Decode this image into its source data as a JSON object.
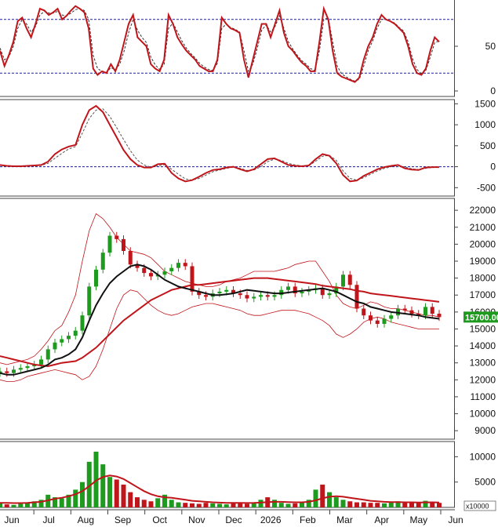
{
  "chart_data": [
    {
      "panel": "stochastic",
      "type": "line",
      "ylim": [
        0,
        100
      ],
      "y_ticks": [
        0,
        50
      ],
      "reference_lines": [
        20,
        80
      ],
      "grid": false,
      "colors": {
        "k_line": "#c0151a",
        "d_line": "#333333",
        "reference": "#1a1aa0"
      },
      "series": [
        {
          "values": [
            45,
            28,
            40,
            55,
            78,
            82,
            70,
            60,
            75,
            92,
            90,
            85,
            88,
            92,
            80,
            84,
            90,
            95,
            92,
            88,
            70,
            25,
            18,
            22,
            20,
            30,
            22,
            35,
            55,
            75,
            85,
            60,
            55,
            50,
            30,
            25,
            22,
            35,
            85,
            75,
            60,
            52,
            45,
            40,
            35,
            28,
            25,
            22,
            22,
            35,
            82,
            75,
            70,
            68,
            65,
            35,
            15,
            35,
            55,
            75,
            75,
            60,
            75,
            90,
            65,
            50,
            45,
            38,
            32,
            28,
            22,
            22,
            55,
            92,
            80,
            45,
            20,
            16,
            14,
            12,
            10,
            15,
            35,
            50,
            60,
            75,
            85,
            80,
            78,
            75,
            70,
            65,
            50,
            30,
            20,
            18,
            25,
            45,
            60,
            55
          ]
        },
        {
          "values": [
            48,
            35,
            38,
            50,
            70,
            80,
            75,
            66,
            72,
            85,
            89,
            87,
            87,
            89,
            85,
            84,
            87,
            91,
            92,
            90,
            80,
            40,
            25,
            22,
            21,
            26,
            24,
            30,
            45,
            65,
            80,
            68,
            60,
            54,
            38,
            29,
            24,
            30,
            70,
            76,
            66,
            56,
            48,
            42,
            37,
            31,
            27,
            24,
            23,
            31,
            70,
            75,
            71,
            69,
            66,
            45,
            22,
            30,
            48,
            68,
            74,
            66,
            72,
            84,
            70,
            55,
            47,
            40,
            34,
            30,
            25,
            23,
            45,
            80,
            82,
            55,
            28,
            19,
            16,
            13,
            11,
            13,
            28,
            45,
            56,
            70,
            80,
            80,
            78,
            76,
            71,
            67,
            55,
            36,
            24,
            19,
            23,
            38,
            54,
            56
          ]
        }
      ]
    },
    {
      "panel": "macd",
      "type": "line",
      "ylim": [
        -700,
        1600
      ],
      "y_ticks": [
        1500,
        1000,
        500,
        0,
        -500
      ],
      "reference_lines": [
        0
      ],
      "grid": false,
      "colors": {
        "macd_line": "#c0151a",
        "signal_line": "#555555",
        "reference": "#1a1aa0"
      },
      "series": [
        {
          "values": [
            40,
            20,
            10,
            10,
            20,
            30,
            40,
            120,
            300,
            410,
            480,
            520,
            1000,
            1350,
            1450,
            1300,
            1000,
            700,
            400,
            180,
            40,
            -20,
            -20,
            60,
            70,
            -150,
            -280,
            -350,
            -320,
            -240,
            -150,
            -80,
            -60,
            -20,
            0,
            -60,
            -110,
            -60,
            60,
            180,
            200,
            120,
            40,
            20,
            10,
            30,
            180,
            300,
            260,
            80,
            -200,
            -350,
            -330,
            -220,
            -140,
            -60,
            -10,
            20,
            40,
            -40,
            -70,
            -80,
            -20,
            -10,
            -10
          ]
        },
        {
          "values": [
            30,
            25,
            18,
            14,
            16,
            22,
            30,
            80,
            200,
            320,
            420,
            480,
            800,
            1150,
            1350,
            1380,
            1200,
            930,
            650,
            380,
            160,
            40,
            -10,
            20,
            50,
            -60,
            -180,
            -290,
            -320,
            -280,
            -200,
            -120,
            -80,
            -40,
            -10,
            -40,
            -90,
            -80,
            0,
            120,
            180,
            150,
            80,
            40,
            20,
            25,
            130,
            250,
            270,
            150,
            -100,
            -280,
            -320,
            -260,
            -180,
            -100,
            -40,
            0,
            30,
            -10,
            -50,
            -70,
            -40,
            -20,
            -15
          ]
        }
      ]
    },
    {
      "panel": "price",
      "type": "candlestick",
      "ylim": [
        8500,
        22700
      ],
      "y_ticks": [
        22000,
        21000,
        20000,
        19000,
        18000,
        17000,
        16000,
        15000,
        14000,
        13000,
        12000,
        11000,
        10000,
        9000
      ],
      "last_price_label": "15700.00",
      "x_ticks": [
        "Jun",
        "Jul",
        "Aug",
        "Sep",
        "Oct",
        "Nov",
        "Dec",
        "2026",
        "Feb",
        "Mar",
        "Apr",
        "May",
        "Jun"
      ],
      "grid": false,
      "colors": {
        "up": "#1e9a1e",
        "down": "#c0151a",
        "ma_long": "#c0151a",
        "ma_short": "#111111",
        "bands": "#c0151a",
        "price_box": "#1e9a1e"
      },
      "close": [
        12500,
        12400,
        12600,
        12700,
        12800,
        12900,
        13200,
        13800,
        14200,
        14400,
        14600,
        14900,
        15800,
        17500,
        18500,
        19500,
        20500,
        20300,
        19600,
        18800,
        18600,
        18300,
        18100,
        18200,
        18400,
        18600,
        18900,
        18700,
        17200,
        17000,
        16900,
        17100,
        17200,
        17300,
        17100,
        17000,
        16800,
        16900,
        17000,
        16900,
        17000,
        17300,
        17500,
        17100,
        17200,
        17300,
        17400,
        17000,
        17100,
        17500,
        18200,
        17600,
        16200,
        15800,
        15500,
        15300,
        15600,
        15800,
        16200,
        16100,
        15900,
        15800,
        16300,
        15900,
        15700
      ],
      "ma_long": [
        13400,
        13300,
        13200,
        13100,
        13000,
        12900,
        12850,
        12800,
        12900,
        13000,
        13050,
        13100,
        13300,
        13600,
        13900,
        14300,
        14700,
        15100,
        15500,
        15800,
        16100,
        16400,
        16700,
        16900,
        17100,
        17300,
        17400,
        17500,
        17600,
        17600,
        17650,
        17700,
        17750,
        17800,
        17850,
        17900,
        17950,
        18000,
        18000,
        18000,
        17950,
        17900,
        17850,
        17800,
        17750,
        17700,
        17650,
        17550,
        17500,
        17450,
        17400,
        17350,
        17250,
        17200,
        17100,
        17050,
        17000,
        16950,
        16900,
        16850,
        16800,
        16750,
        16700,
        16650,
        16600
      ],
      "ma_short": [
        12400,
        12300,
        12300,
        12400,
        12500,
        12600,
        12700,
        12900,
        13200,
        13300,
        13500,
        13800,
        14500,
        15500,
        16400,
        17100,
        17700,
        18100,
        18400,
        18700,
        18800,
        18700,
        18500,
        18200,
        17900,
        17700,
        17500,
        17400,
        17300,
        17200,
        17100,
        17000,
        17000,
        17050,
        17100,
        17200,
        17300,
        17250,
        17200,
        17150,
        17100,
        17100,
        17150,
        17200,
        17250,
        17300,
        17350,
        17400,
        17300,
        17200,
        17000,
        16800,
        16600,
        16500,
        16300,
        16200,
        16100,
        16000,
        15950,
        15900,
        15850,
        15800,
        15700,
        15650,
        15600
      ],
      "upper_band": [
        13000,
        12900,
        13000,
        13100,
        13200,
        13400,
        13800,
        14300,
        14900,
        15200,
        16000,
        17000,
        19000,
        20800,
        21800,
        21500,
        21000,
        20400,
        20000,
        19600,
        19500,
        19400,
        19200,
        18800,
        18400,
        18200,
        18000,
        17800,
        17700,
        17600,
        17500,
        17500,
        17600,
        17800,
        17900,
        18000,
        18200,
        18400,
        18400,
        18400,
        18400,
        18500,
        18600,
        18800,
        18900,
        19000,
        19000,
        18400,
        17800,
        17000,
        16500,
        16300,
        16200,
        16400,
        16600,
        16500,
        16300,
        16200,
        16200,
        16100,
        16000,
        15900,
        15800,
        15800,
        15700
      ],
      "lower_band": [
        12000,
        11900,
        11900,
        12000,
        12200,
        12300,
        12400,
        12500,
        12600,
        12500,
        12400,
        12300,
        12000,
        12200,
        12800,
        13800,
        15000,
        16200,
        17000,
        17300,
        17200,
        16800,
        16400,
        16100,
        15900,
        15800,
        15900,
        16100,
        16300,
        16400,
        16500,
        16500,
        16400,
        16300,
        16200,
        16100,
        15900,
        15800,
        15800,
        15900,
        16000,
        16100,
        16100,
        16100,
        16000,
        15900,
        15700,
        15500,
        15200,
        14700,
        14500,
        14700,
        15000,
        15400,
        15600,
        15700,
        15600,
        15400,
        15300,
        15200,
        15100,
        15000,
        15000,
        15000,
        15000
      ]
    },
    {
      "panel": "volume",
      "type": "bar",
      "ylim": [
        0,
        13000
      ],
      "y_ticks": [
        10000,
        5000
      ],
      "multiplier_label": "x10000",
      "colors": {
        "up": "#1e9a1e",
        "down": "#c0151a",
        "ma": "#c0151a"
      },
      "values": [
        800,
        600,
        500,
        700,
        900,
        1200,
        1500,
        2500,
        2000,
        1800,
        2500,
        3500,
        5000,
        9000,
        11000,
        8500,
        6000,
        5500,
        4500,
        3000,
        2000,
        1500,
        1200,
        1800,
        2500,
        1500,
        1000,
        900,
        800,
        700,
        900,
        800,
        700,
        600,
        900,
        800,
        700,
        1000,
        1500,
        2000,
        1500,
        900,
        700,
        800,
        1000,
        1500,
        3500,
        4500,
        3000,
        2000,
        1500,
        1200,
        1000,
        1000,
        900,
        900,
        800,
        1000,
        1200,
        900,
        1000,
        900,
        1300,
        1100,
        900
      ],
      "ma": [
        900,
        900,
        850,
        850,
        900,
        1000,
        1100,
        1400,
        1700,
        1900,
        2200,
        2600,
        3200,
        4200,
        5300,
        6000,
        6300,
        6100,
        5600,
        4800,
        4000,
        3200,
        2600,
        2200,
        2000,
        1900,
        1700,
        1500,
        1300,
        1200,
        1100,
        1000,
        950,
        900,
        900,
        880,
        870,
        880,
        950,
        1050,
        1100,
        1100,
        1050,
        1000,
        1000,
        1100,
        1400,
        1800,
        2100,
        2200,
        2100,
        1900,
        1700,
        1500,
        1300,
        1200,
        1100,
        1050,
        1050,
        1000,
        1000,
        980,
        990,
        1000,
        980
      ]
    }
  ]
}
